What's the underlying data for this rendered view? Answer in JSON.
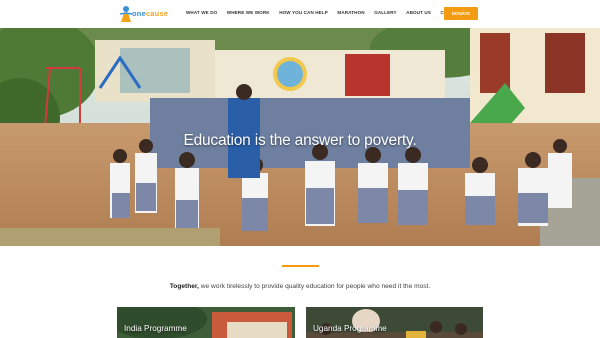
{
  "brand": {
    "name_part1": "1",
    "name_part2": "one",
    "name_part3": "cause",
    "colors": {
      "accent": "#f39c12",
      "blue": "#3a8fd6"
    }
  },
  "nav": {
    "items": [
      {
        "label": "WHAT WE DO"
      },
      {
        "label": "WHERE WE WORK"
      },
      {
        "label": "HOW YOU CAN HELP"
      },
      {
        "label": "MARATHON"
      },
      {
        "label": "GALLERY"
      },
      {
        "label": "ABOUT US"
      },
      {
        "label": "CONTACT US"
      }
    ],
    "donate_label": "DONATE"
  },
  "hero": {
    "caption": "Education is the answer to poverty.",
    "image": "schoolchildren-in-uniform-photo"
  },
  "mission": {
    "lead": "Together,",
    "text": " we work tirelessly to provide quality education for people who need it the most."
  },
  "programmes": [
    {
      "label": "India Programme"
    },
    {
      "label": "Uganda Programme"
    }
  ]
}
